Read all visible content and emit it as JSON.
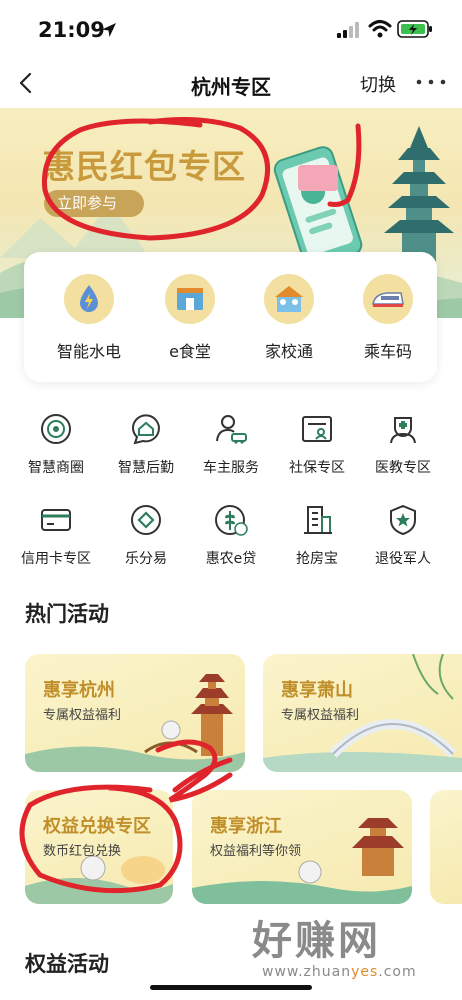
{
  "status_bar": {
    "time": "21:09"
  },
  "nav": {
    "title": "杭州专区",
    "switch_label": "切换"
  },
  "hero": {
    "title": "惠民红包专区",
    "button_label": "立即参与"
  },
  "quick_services": [
    {
      "label": "智能水电",
      "icon": "water-electric-icon"
    },
    {
      "label": "e食堂",
      "icon": "canteen-icon"
    },
    {
      "label": "家校通",
      "icon": "school-icon"
    },
    {
      "label": "乘车码",
      "icon": "train-icon"
    }
  ],
  "services_row1": [
    {
      "label": "智慧商圈",
      "icon": "shop-circle-icon"
    },
    {
      "label": "智慧后勤",
      "icon": "house-bubble-icon"
    },
    {
      "label": "车主服务",
      "icon": "car-owner-icon"
    },
    {
      "label": "社保专区",
      "icon": "social-security-icon"
    },
    {
      "label": "医教专区",
      "icon": "medical-icon"
    }
  ],
  "services_row2": [
    {
      "label": "信用卡专区",
      "icon": "credit-card-icon"
    },
    {
      "label": "乐分易",
      "icon": "diamond-circle-icon"
    },
    {
      "label": "惠农e贷",
      "icon": "wheat-icon"
    },
    {
      "label": "抢房宝",
      "icon": "building-icon"
    },
    {
      "label": "退役军人",
      "icon": "star-shield-icon"
    }
  ],
  "hot_activities": {
    "title": "热门活动",
    "cards": [
      {
        "title": "惠享杭州",
        "subtitle": "专属权益福利"
      },
      {
        "title": "惠享萧山",
        "subtitle": "专属权益福利"
      },
      {
        "title": "权益兑换专区",
        "subtitle": "数币红包兑换"
      },
      {
        "title": "惠享浙江",
        "subtitle": "权益福利等你领"
      }
    ]
  },
  "rights_activities": {
    "title": "权益活动"
  },
  "watermark": {
    "main": "好赚网",
    "sub_prefix": "www.zhuan",
    "sub_highlight": "yes",
    "sub_suffix": ".com"
  },
  "colors": {
    "accent_gold": "#c89a3c",
    "icon_green": "#2e7d5b",
    "annotation_red": "#e0242c"
  }
}
